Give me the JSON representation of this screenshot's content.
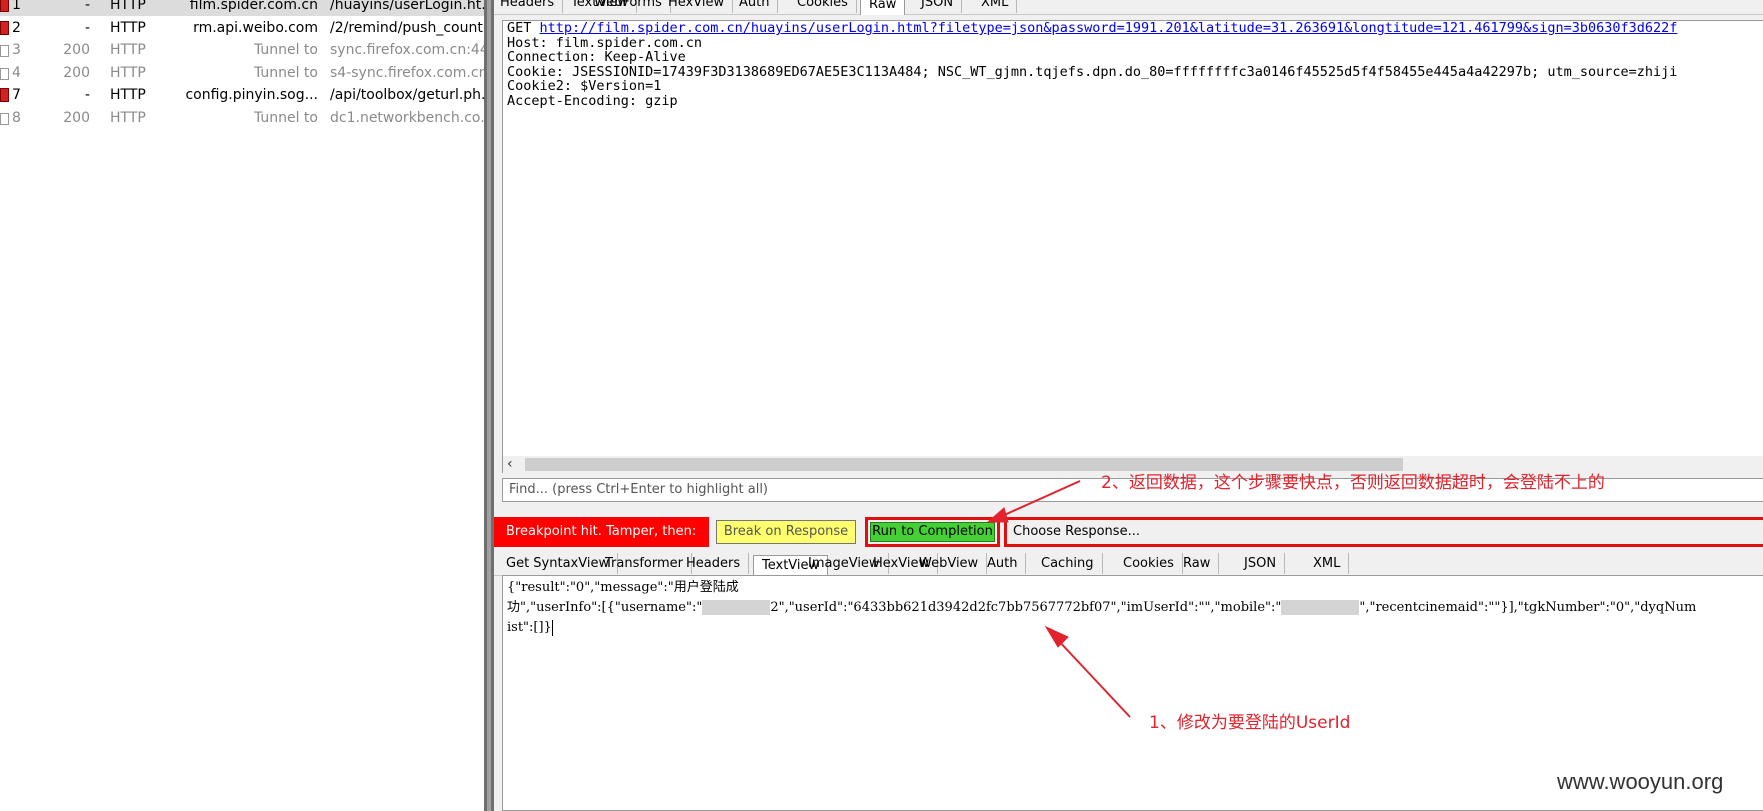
{
  "sessions": [
    {
      "num": "1",
      "result": "-",
      "protocol": "HTTP",
      "host": "film.spider.com.cn",
      "url": "/huayins/userLogin.ht...",
      "icon": "breakpoint-icon",
      "selected": true,
      "grey": false
    },
    {
      "num": "2",
      "result": "-",
      "protocol": "HTTP",
      "host": "rm.api.weibo.com",
      "url": "/2/remind/push_count...",
      "icon": "breakpoint-icon",
      "selected": false,
      "grey": false
    },
    {
      "num": "3",
      "result": "200",
      "protocol": "HTTP",
      "host": "Tunnel to",
      "url": "sync.firefox.com.cn:44...",
      "icon": "lock-icon",
      "selected": false,
      "grey": true
    },
    {
      "num": "4",
      "result": "200",
      "protocol": "HTTP",
      "host": "Tunnel to",
      "url": "s4-sync.firefox.com.cn...",
      "icon": "lock-icon",
      "selected": false,
      "grey": true
    },
    {
      "num": "7",
      "result": "-",
      "protocol": "HTTP",
      "host": "config.pinyin.sog...",
      "url": "/api/toolbox/geturl.ph...",
      "icon": "breakpoint-icon",
      "selected": false,
      "grey": false
    },
    {
      "num": "8",
      "result": "200",
      "protocol": "HTTP",
      "host": "Tunnel to",
      "url": "dc1.networkbench.co...",
      "icon": "lock-icon",
      "selected": false,
      "grey": true
    }
  ],
  "request_tabs": [
    "Headers",
    "TextView",
    "WebForms",
    "HexView",
    "Auth",
    "Cookies",
    "Raw",
    "JSON",
    "XML"
  ],
  "request_active_tab": "Raw",
  "request": {
    "method": "GET ",
    "url": "http://film.spider.com.cn/huayins/userLogin.html?filetype=json&password=1991.201&latitude=31.263691&longtitude=121.461799&sign=3b0630f3d622f",
    "lines": [
      "Host: film.spider.com.cn",
      "Connection: Keep-Alive",
      "Cookie: JSESSIONID=17439F3D3138689ED67AE5E3C113A484; NSC_WT_gjmn.tqjefs.dpn.do_80=ffffffffc3a0146f45525d5f4f58455e445a4a42297b; utm_source=zhiji",
      "Cookie2: $Version=1",
      "Accept-Encoding: gzip"
    ]
  },
  "find_placeholder": "Find... (press Ctrl+Enter to highlight all)",
  "breakpoint": {
    "label": "Breakpoint hit. Tamper, then:",
    "break_on_response": "Break on Response",
    "run_to_completion": "Run to Completion",
    "choose_response": "Choose Response..."
  },
  "response_tabs": [
    "Get SyntaxView",
    "Transformer",
    "Headers",
    "TextView",
    "ImageView",
    "HexView",
    "WebView",
    "Auth",
    "Caching",
    "Cookies",
    "Raw",
    "JSON",
    "XML"
  ],
  "response_active_tab": "TextView",
  "response": {
    "line1": "{\"result\":\"0\",\"message\":\"用户登陆成",
    "line2_a": "功\",\"userInfo\":[{\"username\":\"",
    "line2_b": "2\",\"userId\":\"6433bb621d3942d2fc7bb7567772bf07\",\"imUserId\":\"\",\"mobile\":\"",
    "line2_c": "\",\"recentcinemaid\":\"\"}],\"tgkNumber\":\"0\",\"dyqNum",
    "line3": "ist\":[]}"
  },
  "annotations": {
    "note1": "1、修改为要登陆的UserId",
    "note2": "2、返回数据，这个步骤要快点，否则返回数据超时，会登陆不上的"
  },
  "watermark": "www.wooyun.org",
  "colors": {
    "annotation_red": "#e0232d",
    "breakpoint_red": "#ff0000",
    "break_yellow": "#ffff6e",
    "run_green": "#44d034"
  }
}
